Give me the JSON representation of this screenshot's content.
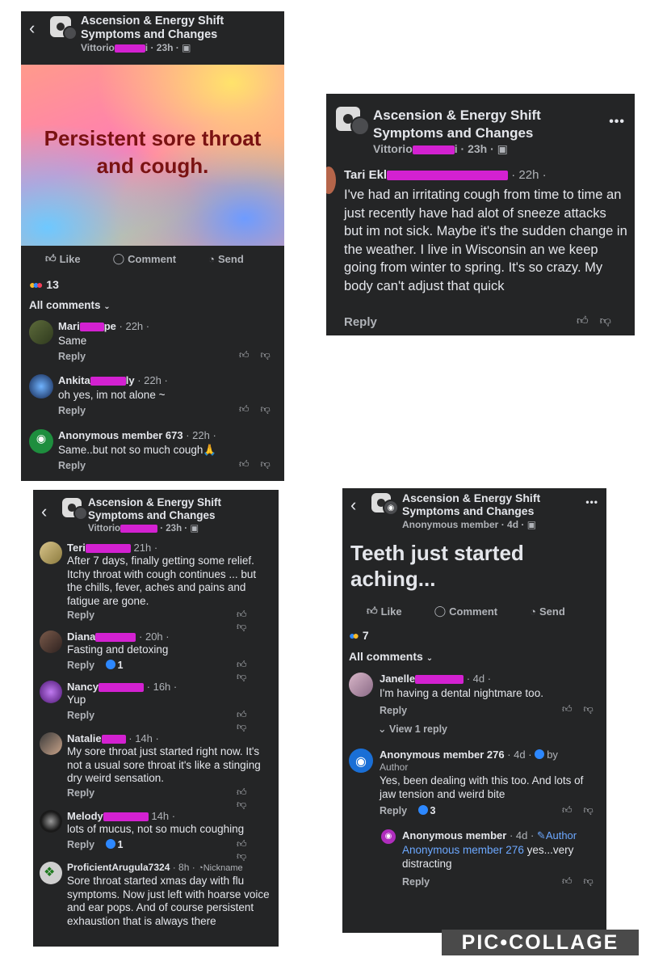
{
  "group": {
    "line1": "Ascension & Energy Shift",
    "line2": "Symptoms and Changes"
  },
  "panel1": {
    "author": "Vittorio",
    "author_tail": "i",
    "time": "· 23h ·",
    "post_text": "Persistent sore throat and cough.",
    "actions": {
      "like": "Like",
      "comment": "Comment",
      "send": "Send"
    },
    "reaction_count": "13",
    "all_comments": "All comments",
    "comments": [
      {
        "name": "Mari",
        "name_tail": "pe",
        "time": "· 22h ·",
        "text": "Same",
        "reply": "Reply"
      },
      {
        "name": "Ankita",
        "name_tail": "ly",
        "time": "· 22h ·",
        "text": "oh yes, im not alone ~",
        "reply": "Reply"
      },
      {
        "name": "Anonymous member 673",
        "name_tail": "",
        "time": "· 22h ·",
        "text": "Same..but not so much cough🙏",
        "reply": "Reply"
      }
    ]
  },
  "panel2": {
    "author": "Vittorio",
    "author_tail": "i",
    "time": "· 23h ·",
    "comment": {
      "name": "Tari Ekl",
      "time": "· 22h ·",
      "text": "I've had an irritating cough from time to time an just recently have had alot of sneeze attacks but im not sick. Maybe it's the sudden change in the weather. I live in Wisconsin an we keep going from winter to spring. It's so crazy. My body can't adjust that quick",
      "reply": "Reply"
    }
  },
  "panel3": {
    "author": "Vittorio",
    "time": "· 23h ·",
    "comments": [
      {
        "name": "Teri",
        "time": "21h ·",
        "text": "After 7 days, finally getting some relief. Itchy throat with cough continues ... but the chills, fever, aches and pains and fatigue are gone.",
        "reply": "Reply",
        "likes": ""
      },
      {
        "name": "Diana",
        "time": "· 20h ·",
        "text": "Fasting and detoxing",
        "reply": "Reply",
        "likes": "1"
      },
      {
        "name": "Nancy",
        "time": "· 16h ·",
        "text": "Yup",
        "reply": "Reply",
        "likes": ""
      },
      {
        "name": "Natalie",
        "time": "· 14h ·",
        "text": "My sore throat just started right now. It's not a usual sore throat it's like a stinging dry weird sensation.",
        "reply": "Reply",
        "likes": ""
      },
      {
        "name": "Melody",
        "time": "14h ·",
        "text": "lots of mucus, not so much coughing",
        "reply": "Reply",
        "likes": "1"
      },
      {
        "name": "ProficientArugula7324",
        "time": "· 8h ·",
        "badge": "Nickname",
        "text": "Sore throat started xmas day with flu symptoms. Now just left with hoarse voice and ear pops. And of course persistent exhaustion that is always there",
        "reply": "",
        "likes": ""
      }
    ]
  },
  "panel4": {
    "author": "Anonymous member",
    "time": "· 4d ·",
    "post_text": "Teeth just started aching...",
    "actions": {
      "like": "Like",
      "comment": "Comment",
      "send": "Send"
    },
    "reaction_count": "7",
    "all_comments": "All comments",
    "c1": {
      "name": "Janelle",
      "time": "· 4d ·",
      "text": "I'm having a dental nightmare too.",
      "reply": "Reply",
      "view": "View 1 reply"
    },
    "c2": {
      "name": "Anonymous member 276",
      "time": "· 4d ·",
      "by": "by",
      "author_label": "Author",
      "text": "Yes, been dealing with this too. And lots of jaw tension and weird bite",
      "reply": "Reply",
      "likes": "3"
    },
    "c3": {
      "name": "Anonymous member",
      "time": "· 4d ·",
      "author_label": "Author",
      "mention": "Anonymous member 276",
      "text": "yes...very distracting",
      "reply": "Reply"
    }
  },
  "watermark": "PIC•COLLAGE"
}
